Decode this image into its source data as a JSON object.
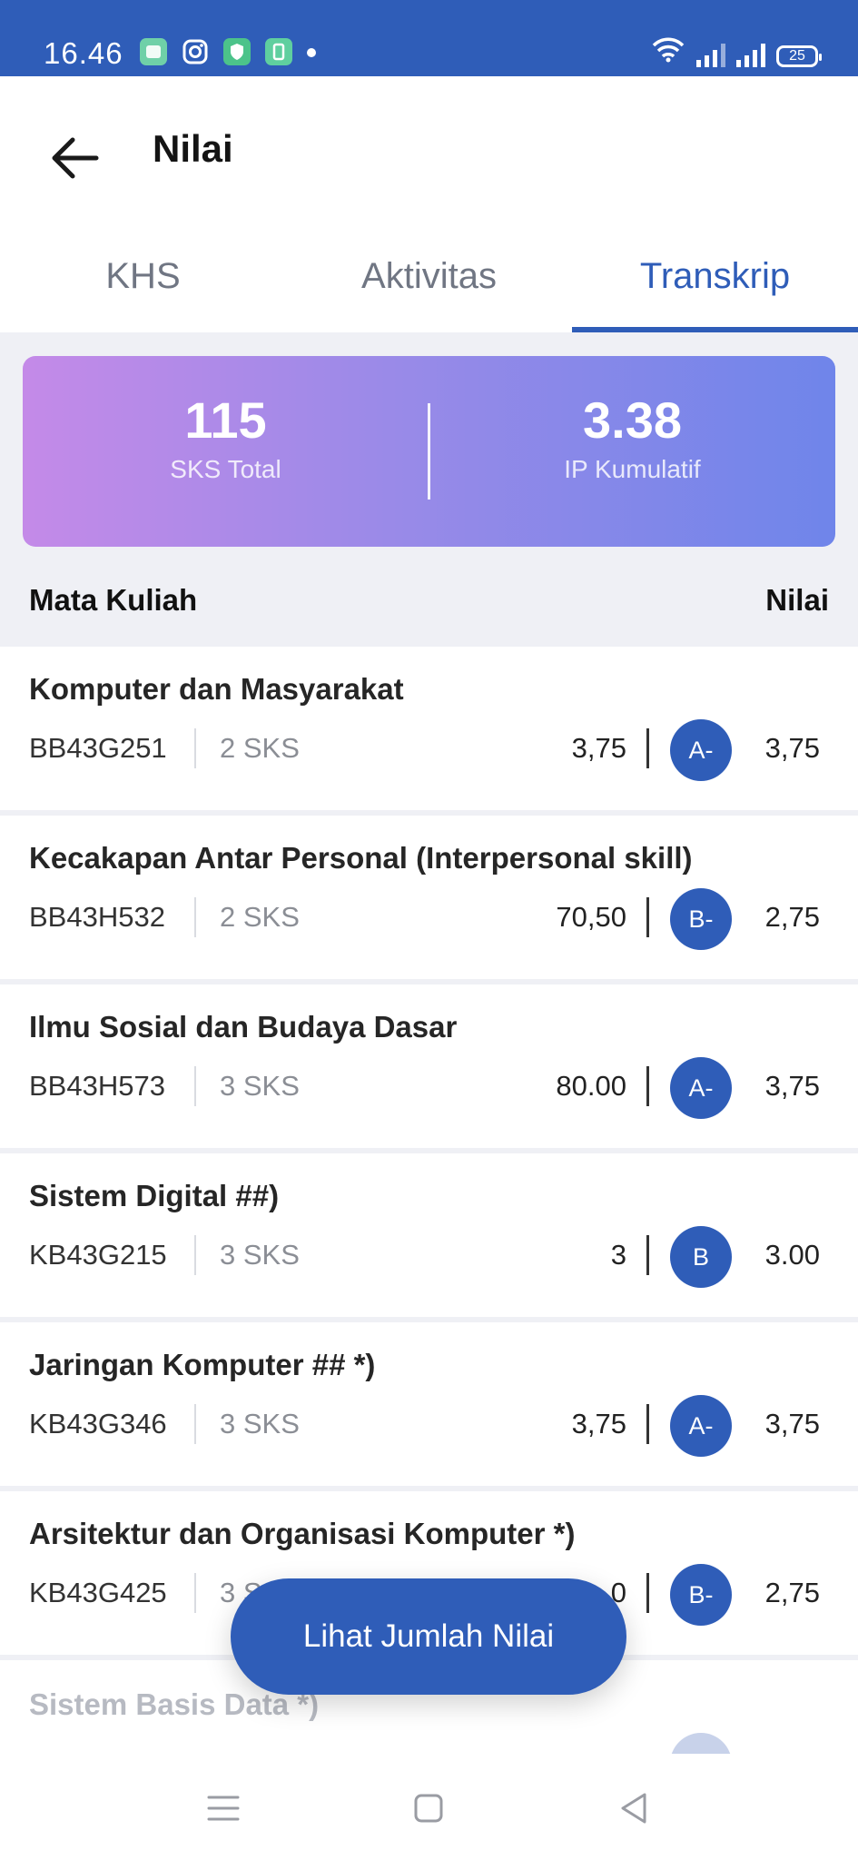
{
  "status_bar": {
    "time": "16.46",
    "battery": "25",
    "colors": {
      "background": "#2f5db8"
    },
    "icons": [
      "gallery-app-icon",
      "instagram-icon",
      "shield-app-icon",
      "sim-app-icon",
      "wifi-icon",
      "signal-icon",
      "signal-icon",
      "battery-icon"
    ]
  },
  "header": {
    "title": "Nilai"
  },
  "tabs": [
    {
      "label": "KHS",
      "active": false
    },
    {
      "label": "Aktivitas",
      "active": false
    },
    {
      "label": "Transkrip",
      "active": true
    }
  ],
  "summary": {
    "sks_total_value": "115",
    "sks_total_label": "SKS Total",
    "ipk_value": "3.38",
    "ipk_label": "IP Kumulatif",
    "colors": {
      "gradient_start": "#c48ae8",
      "gradient_end": "#6f85ea"
    }
  },
  "list_header": {
    "course_label": "Mata Kuliah",
    "grade_label": "Nilai"
  },
  "courses": [
    {
      "name": "Komputer dan Masyarakat",
      "code": "BB43G251",
      "sks": "2 SKS",
      "score": "3,75",
      "grade": "A-",
      "point": "3,75"
    },
    {
      "name": "Kecakapan Antar Personal (Interpersonal skill)",
      "code": "BB43H532",
      "sks": "2 SKS",
      "score": "70,50",
      "grade": "B-",
      "point": "2,75"
    },
    {
      "name": "Ilmu Sosial dan Budaya Dasar",
      "code": "BB43H573",
      "sks": "3 SKS",
      "score": "80.00",
      "grade": "A-",
      "point": "3,75"
    },
    {
      "name": "Sistem Digital ##)",
      "code": "KB43G215",
      "sks": "3 SKS",
      "score": "3",
      "grade": "B",
      "point": "3.00"
    },
    {
      "name": "Jaringan Komputer ## *)",
      "code": "KB43G346",
      "sks": "3 SKS",
      "score": "3,75",
      "grade": "A-",
      "point": "3,75"
    },
    {
      "name": "Arsitektur dan Organisasi Komputer *)",
      "code": "KB43G425",
      "sks": "3 S",
      "score": "0",
      "grade": "B-",
      "point": "2,75"
    },
    {
      "name": "Sistem Basis Data *)"
    }
  ],
  "fab": {
    "label": "Lihat Jumlah Nilai"
  },
  "colors": {
    "primary": "#2f5db8",
    "page_background": "#eff0f5"
  }
}
